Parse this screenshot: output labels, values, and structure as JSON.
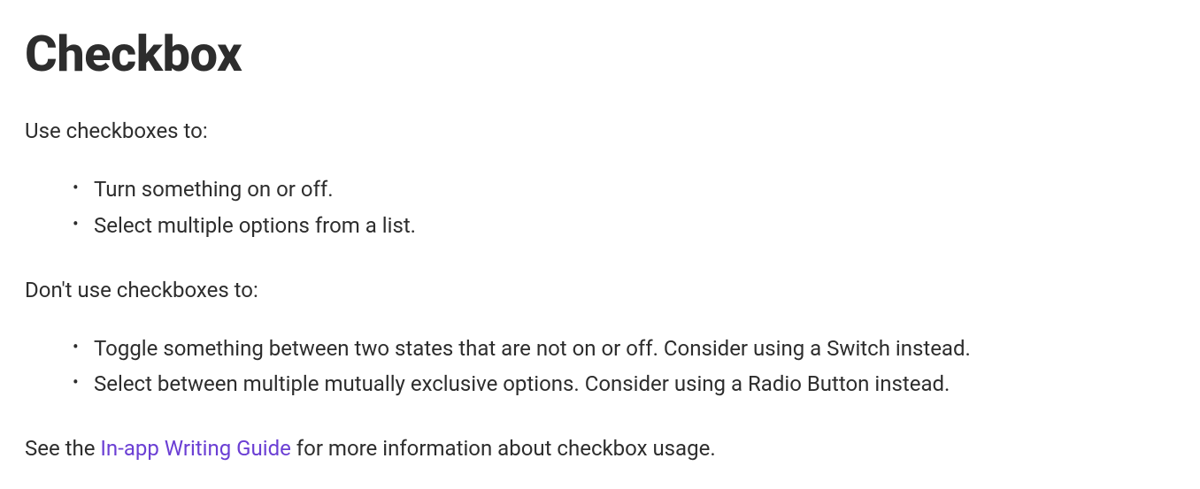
{
  "heading": "Checkbox",
  "intro_use": "Use checkboxes to:",
  "use_list": {
    "item0": "Turn something on or off.",
    "item1": "Select multiple options from a list."
  },
  "intro_dont": "Don't use checkboxes to:",
  "dont_list": {
    "item0": "Toggle something between two states that are not on or off. Consider using a Switch instead.",
    "item1": "Select between multiple mutually exclusive options. Consider using a Radio Button instead."
  },
  "footer": {
    "prefix": "See the ",
    "link_text": "In-app Writing Guide",
    "suffix": " for more information about checkbox usage."
  }
}
